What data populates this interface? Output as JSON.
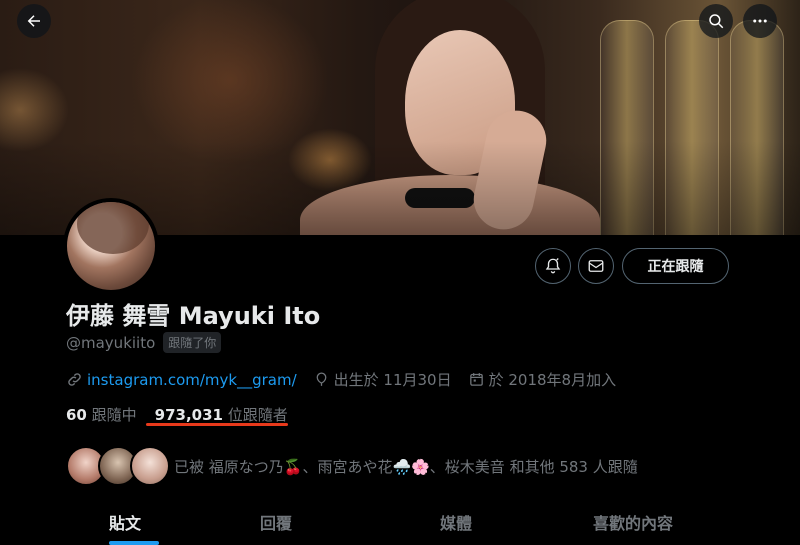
{
  "profile": {
    "display_name": "伊藤 舞雪 Mayuki Ito",
    "handle": "@mayukiito",
    "follows_you_badge": "跟隨了你",
    "link": "instagram.com/myk__gram/",
    "birthday": "出生於 11月30日",
    "joined": "於 2018年8月加入",
    "following_count": "60",
    "following_label": "跟隨中",
    "followers_count": "973,031",
    "followers_label": "位跟隨者",
    "followed_by_text": "已被 福原なつ乃🍒、雨宮あや花🌧️🌸、桜木美音 和其他 583 人跟隨"
  },
  "actions": {
    "following_button": "正在跟隨"
  },
  "icons": {
    "back": "back-arrow-icon",
    "search": "search-icon",
    "more": "more-icon",
    "notify": "bell-icon",
    "message": "mail-icon",
    "link": "link-icon",
    "location": "balloon-icon",
    "calendar": "calendar-icon"
  },
  "tabs": [
    {
      "label": "貼文",
      "active": true
    },
    {
      "label": "回覆",
      "active": false
    },
    {
      "label": "媒體",
      "active": false
    },
    {
      "label": "喜歡的內容",
      "active": false
    }
  ],
  "colors": {
    "accent": "#1d9bf0",
    "annotation_underline": "#e8391b"
  }
}
